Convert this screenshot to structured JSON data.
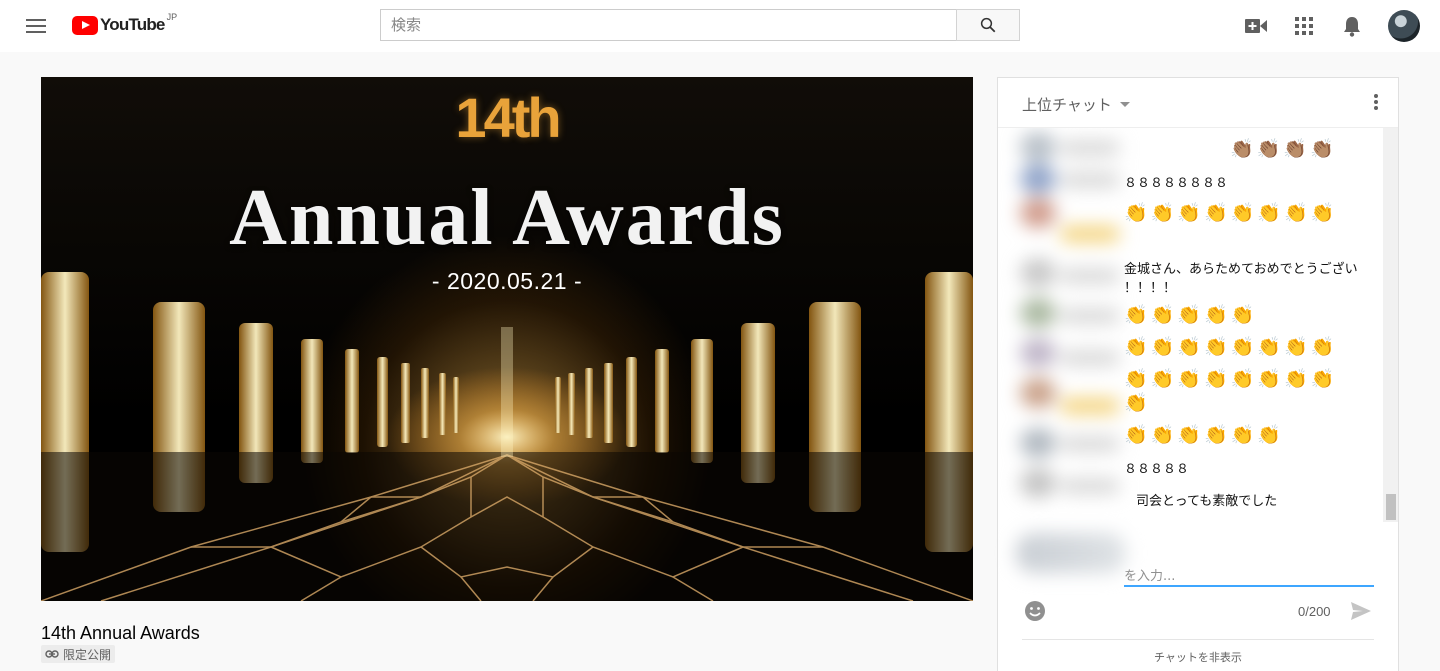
{
  "header": {
    "logo_text": "YouTube",
    "logo_region": "JP",
    "search_placeholder": "検索",
    "icons": [
      "menu-icon",
      "search-icon",
      "create-video-icon",
      "apps-grid-icon",
      "notifications-bell-icon",
      "account-avatar"
    ]
  },
  "player": {
    "art_number": "14th",
    "art_title": "Annual Awards",
    "art_date": "-  2020.05.21  -"
  },
  "video": {
    "title": "14th Annual Awards",
    "visibility": "限定公開"
  },
  "chat": {
    "mode_label": "上位チャット",
    "messages": [
      {
        "text": "👏🏽👏🏽👏🏽👏🏽"
      },
      {
        "text": "８８８８８８８８"
      },
      {
        "text": "👏👏👏👏👏👏👏👏"
      },
      {
        "text": "金城さん、あらためておめでとうござい"
      },
      {
        "text": "！！！！"
      },
      {
        "text": "👏👏👏👏👏"
      },
      {
        "text": "👏👏👏👏👏👏👏👏"
      },
      {
        "text": "👏👏👏👏👏👏👏👏"
      },
      {
        "text": "👏"
      },
      {
        "text": "👏👏👏👏👏👏"
      },
      {
        "text": "８８８８８"
      },
      {
        "text": "司会とっても素敵でした"
      }
    ],
    "input_placeholder": "を入力...",
    "char_count": "0/200",
    "hide_label": "チャットを非表示"
  },
  "colors": {
    "brand_red": "#ff0000",
    "input_focus": "#3ea6ff",
    "clap_yellow": "#f0b73b"
  }
}
